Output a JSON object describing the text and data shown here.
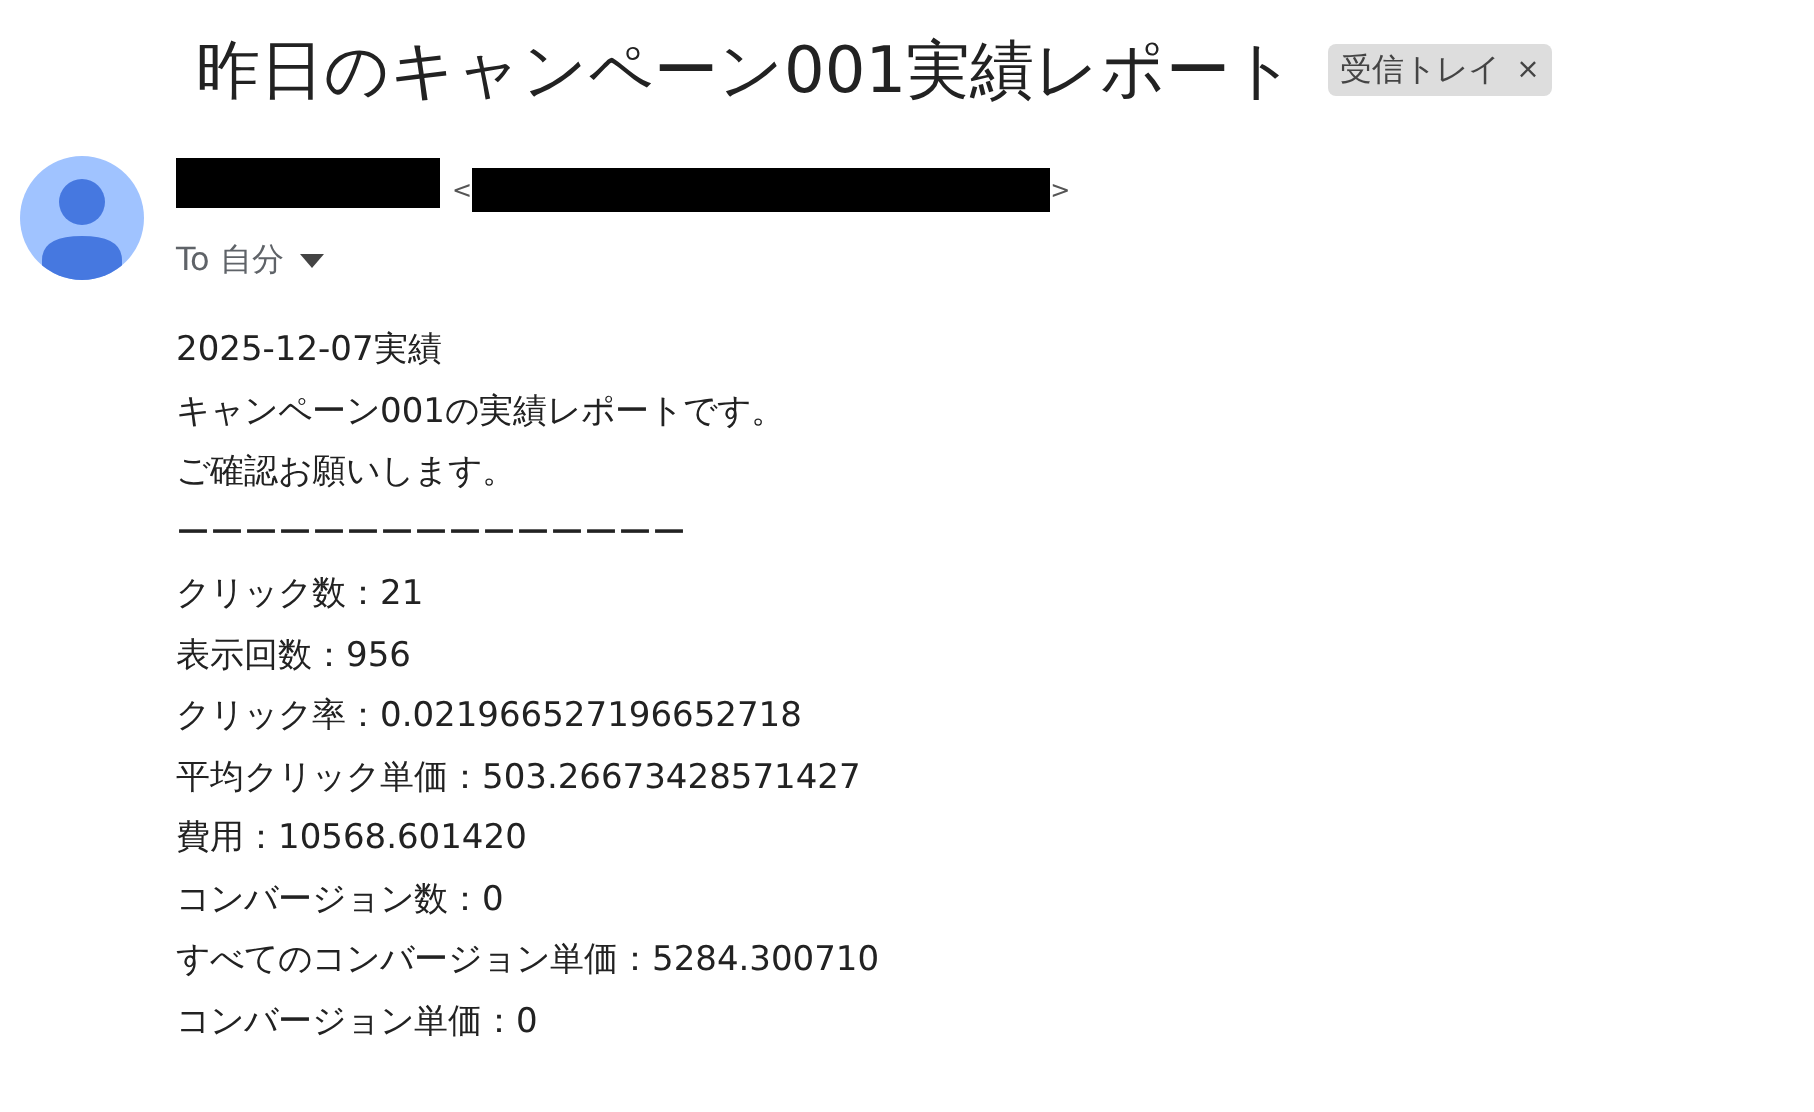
{
  "subject": "昨日のキャンペーン001実績レポート",
  "label": {
    "text": "受信トレイ",
    "close": "×"
  },
  "sender": {
    "open_bracket": "<",
    "close_bracket": ">"
  },
  "recipient": {
    "text": "To 自分"
  },
  "body": [
    "2025-12-07実績",
    "キャンペーン001の実績レポートです。",
    "ご確認お願いします。",
    "ーーーーーーーーーーーーーーー",
    "クリック数：21",
    "表示回数：956",
    "クリック率：0.021966527196652718",
    "平均クリック単価：503.26673428571427",
    "費用：10568.601420",
    "コンバージョン数：0",
    "すべてのコンバージョン単価：5284.300710",
    "コンバージョン単価：0"
  ]
}
